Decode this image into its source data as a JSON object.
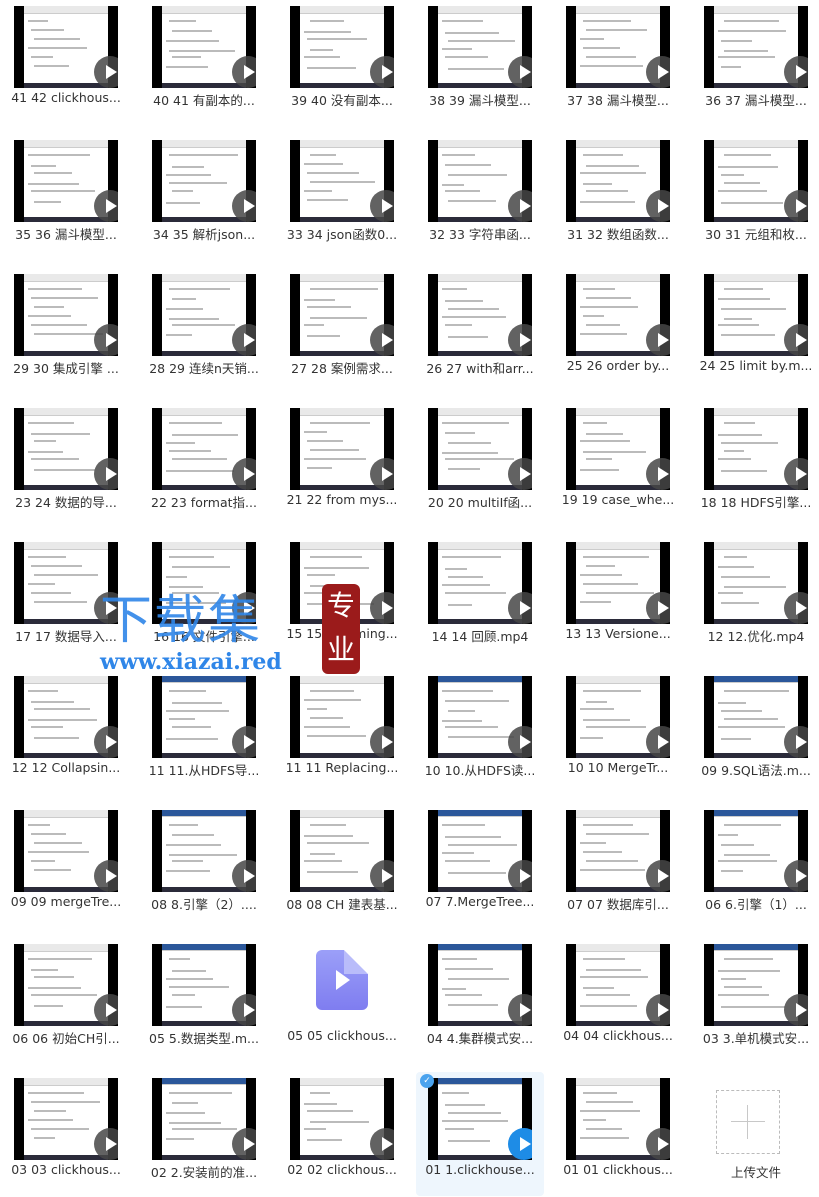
{
  "files": [
    {
      "name": "41 42 clickhous...",
      "thumb": "video"
    },
    {
      "name": "40 41 有副本的...",
      "thumb": "video"
    },
    {
      "name": "39 40 没有副本...",
      "thumb": "video"
    },
    {
      "name": "38 39 漏斗模型...",
      "thumb": "video"
    },
    {
      "name": "37 38 漏斗模型...",
      "thumb": "video"
    },
    {
      "name": "36 37 漏斗模型...",
      "thumb": "video"
    },
    {
      "name": "35 36 漏斗模型...",
      "thumb": "video"
    },
    {
      "name": "34 35 解析json...",
      "thumb": "video"
    },
    {
      "name": "33 34 json函数0...",
      "thumb": "video"
    },
    {
      "name": "32 33 字符串函...",
      "thumb": "video"
    },
    {
      "name": "31 32 数组函数...",
      "thumb": "video"
    },
    {
      "name": "30 31 元组和枚...",
      "thumb": "video"
    },
    {
      "name": "29 30 集成引擎 ...",
      "thumb": "video"
    },
    {
      "name": "28 29 连续n天销...",
      "thumb": "video"
    },
    {
      "name": "27 28 案例需求...",
      "thumb": "video"
    },
    {
      "name": "26 27 with和arr...",
      "thumb": "video"
    },
    {
      "name": "25 26 order by...",
      "thumb": "video"
    },
    {
      "name": "24 25 limit by.m...",
      "thumb": "video"
    },
    {
      "name": "23 24 数据的导...",
      "thumb": "video"
    },
    {
      "name": "22 23 format指...",
      "thumb": "video"
    },
    {
      "name": "21 22 from mys...",
      "thumb": "video"
    },
    {
      "name": "20 20 multiIf函...",
      "thumb": "video"
    },
    {
      "name": "19 19 case_whe...",
      "thumb": "video"
    },
    {
      "name": "18 18 HDFS引擎...",
      "thumb": "video"
    },
    {
      "name": "17 17  数据导入...",
      "thumb": "video"
    },
    {
      "name": "16 16 文件引擎...",
      "thumb": "video"
    },
    {
      "name": "15 15 Summing...",
      "thumb": "video"
    },
    {
      "name": "14 14  回顾.mp4",
      "thumb": "video"
    },
    {
      "name": "13 13 Versione...",
      "thumb": "video"
    },
    {
      "name": "12 12.优化.mp4",
      "thumb": "video"
    },
    {
      "name": "12 12 Collapsin...",
      "thumb": "video"
    },
    {
      "name": "11 11.从HDFS导...",
      "thumb": "word"
    },
    {
      "name": "11 11 Replacing...",
      "thumb": "video"
    },
    {
      "name": "10 10.从HDFS读...",
      "thumb": "word"
    },
    {
      "name": "10 10 MergeTr...",
      "thumb": "video"
    },
    {
      "name": "09 9.SQL语法.m...",
      "thumb": "word"
    },
    {
      "name": "09 09 mergeTre...",
      "thumb": "video"
    },
    {
      "name": "08 8.引擎（2）....",
      "thumb": "word"
    },
    {
      "name": "08 08 CH 建表基...",
      "thumb": "video"
    },
    {
      "name": "07 7.MergeTree...",
      "thumb": "word"
    },
    {
      "name": "07 07 数据库引...",
      "thumb": "video"
    },
    {
      "name": "06 6.引擎（1）...",
      "thumb": "word"
    },
    {
      "name": "06 06 初始CH引...",
      "thumb": "video"
    },
    {
      "name": "05 5.数据类型.m...",
      "thumb": "word"
    },
    {
      "name": "05 05 clickhous...",
      "thumb": "file"
    },
    {
      "name": "04 4.集群模式安...",
      "thumb": "word"
    },
    {
      "name": "04 04 clickhous...",
      "thumb": "video"
    },
    {
      "name": "03 3.单机模式安...",
      "thumb": "word"
    },
    {
      "name": "03 03 clickhous...",
      "thumb": "video"
    },
    {
      "name": "02 2.安装前的准...",
      "thumb": "word"
    },
    {
      "name": "02 02 clickhous...",
      "thumb": "video"
    },
    {
      "name": "01 1.clickhouse...",
      "thumb": "word",
      "selected": true
    },
    {
      "name": "01 01 clickhous...",
      "thumb": "video"
    }
  ],
  "upload": {
    "label": "上传文件",
    "icon": "plus-icon"
  },
  "watermark": {
    "text": "下载集",
    "seal": "专业",
    "url": "www.xiazai.red"
  },
  "colors": {
    "selected_bg": "#eef6fd",
    "accent": "#1e8ce6",
    "file_icon": "#8a8cf3"
  }
}
